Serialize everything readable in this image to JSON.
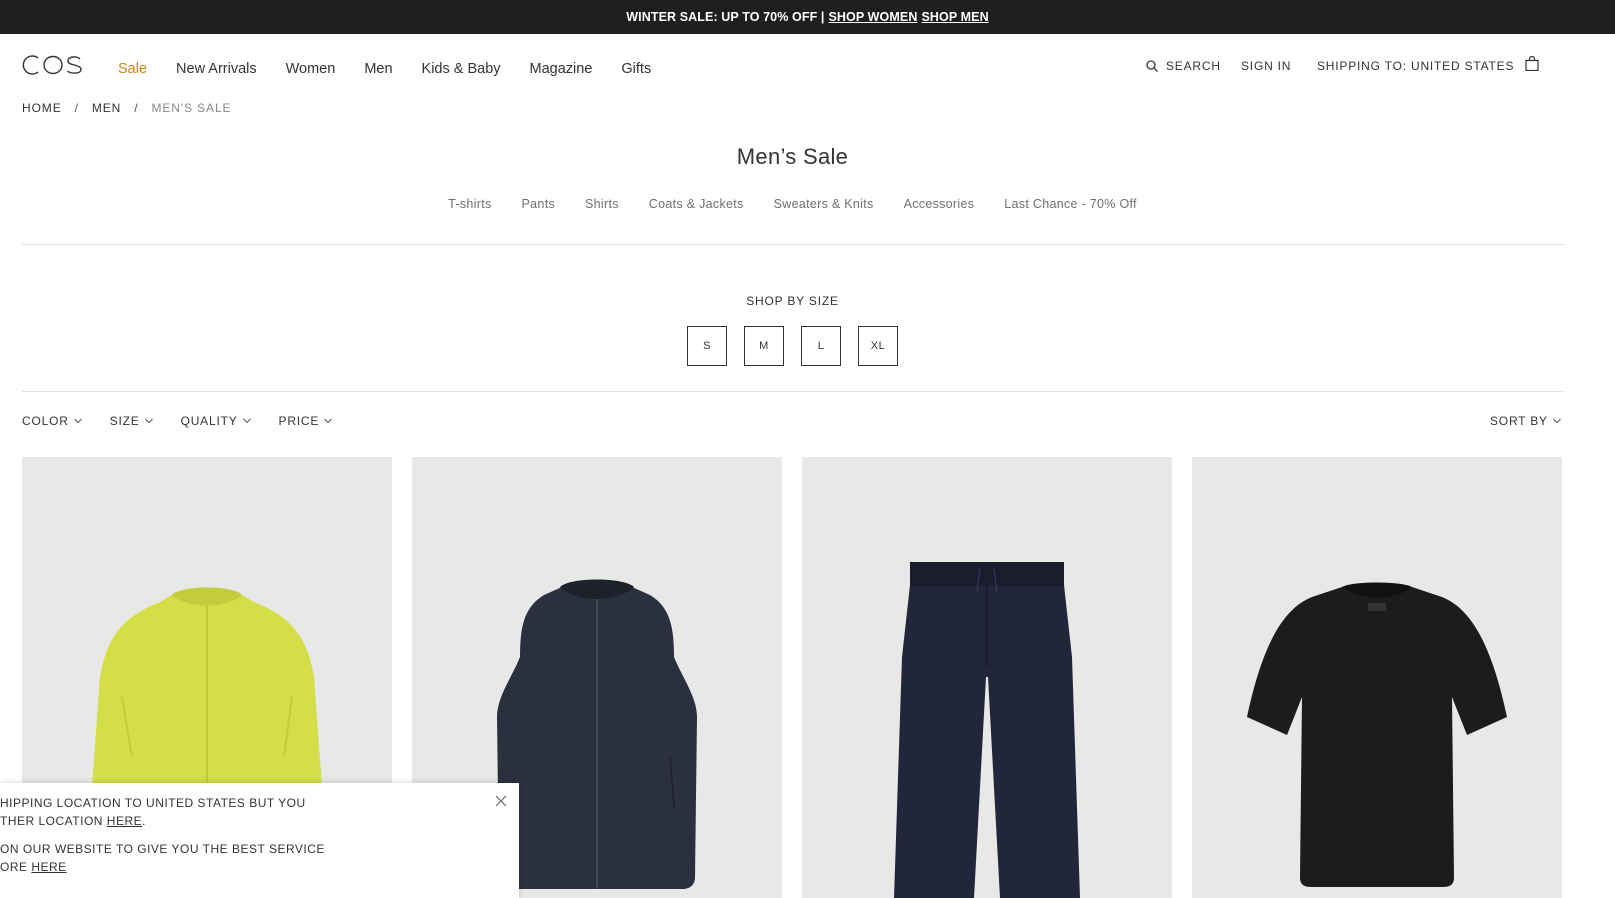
{
  "banner": {
    "text": "WINTER SALE: UP TO 70% OFF |",
    "link_women": "SHOP WOMEN",
    "link_men": "SHOP MEN"
  },
  "header": {
    "logo_text": "COS",
    "nav": [
      "Sale",
      "New Arrivals",
      "Women",
      "Men",
      "Kids & Baby",
      "Magazine",
      "Gifts"
    ],
    "search_label": "SEARCH",
    "signin_label": "SIGN IN",
    "shipping_label": "SHIPPING TO: UNITED STATES"
  },
  "breadcrumb": {
    "items": [
      "HOME",
      "MEN"
    ],
    "current": "MEN'S SALE",
    "separator": "/"
  },
  "page": {
    "title": "Men’s Sale",
    "subcategories": [
      "T-shirts",
      "Pants",
      "Shirts",
      "Coats & Jackets",
      "Sweaters & Knits",
      "Accessories",
      "Last Chance - 70% Off"
    ]
  },
  "shop_by_size": {
    "title": "SHOP BY SIZE",
    "sizes": [
      "S",
      "M",
      "L",
      "XL"
    ]
  },
  "filters": {
    "items": [
      "COLOR",
      "SIZE",
      "QUALITY",
      "PRICE"
    ],
    "sort_label": "SORT BY"
  },
  "products": [
    {
      "type": "jacket",
      "color": "#d6e24a"
    },
    {
      "type": "vest",
      "color": "#2a2f3d"
    },
    {
      "type": "pants",
      "color": "#22263a"
    },
    {
      "type": "tshirt",
      "color": "#1c1c1c"
    }
  ],
  "popup": {
    "line1": "HIPPING LOCATION TO UNITED STATES BUT YOU",
    "line2_prefix": "THER LOCATION ",
    "line2_link": "HERE",
    "line2_suffix": ".",
    "line3": "ON OUR WEBSITE TO GIVE YOU THE BEST SERVICE",
    "line4_prefix": "ORE ",
    "line4_link": "HERE"
  },
  "colors": {
    "banner_bg": "#1f1f1f",
    "sale_accent": "#c8851a",
    "product_bg": "#e8e8e6"
  }
}
